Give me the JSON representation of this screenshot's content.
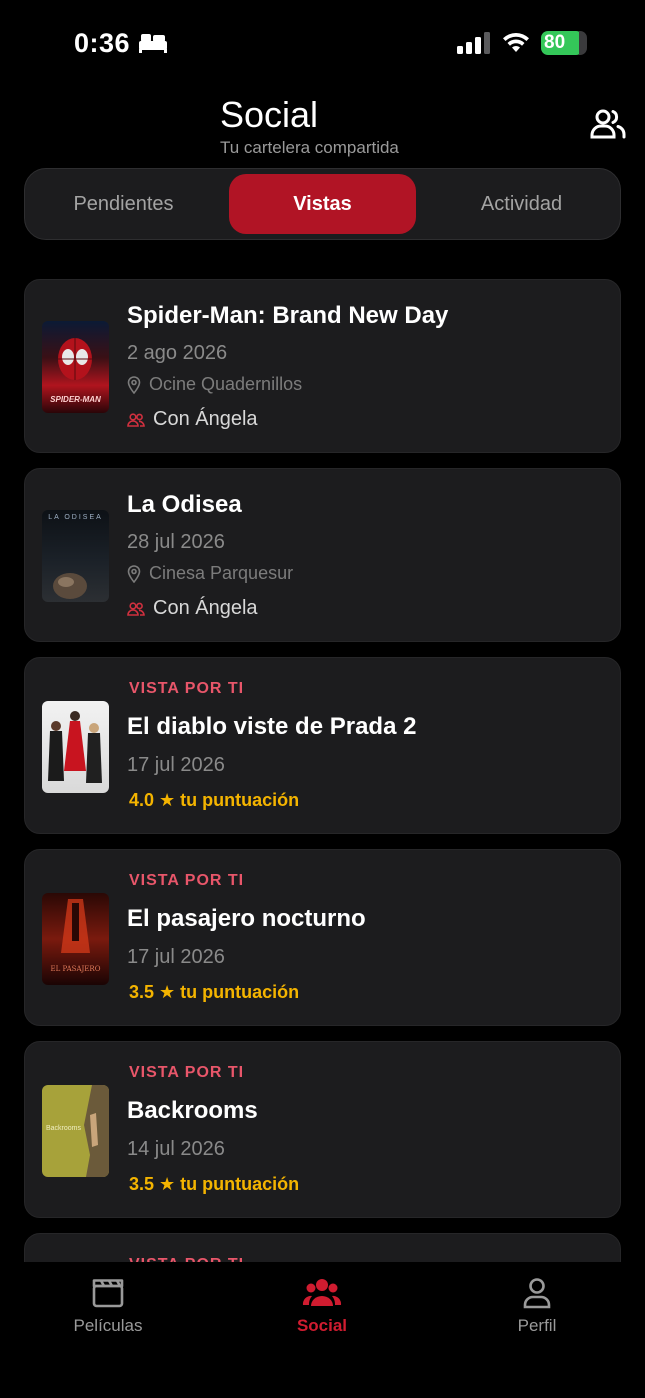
{
  "status_bar": {
    "time": "0:36",
    "battery": "80"
  },
  "header": {
    "title": "Social",
    "subtitle": "Tu cartelera compartida"
  },
  "segments": [
    "Pendientes",
    "Vistas",
    "Actividad"
  ],
  "cards": [
    {
      "title": "Spider-Man: Brand New Day",
      "date": "2 ago 2026",
      "cinema": "Ocine Quadernillos",
      "with": "Con Ángela",
      "poster_text": "SPIDER-MAN"
    },
    {
      "title": "La Odisea",
      "date": "28 jul 2026",
      "cinema": "Cinesa Parquesur",
      "with": "Con Ángela",
      "poster_text": "LA ODISEA"
    },
    {
      "tag": "VISTA POR TI",
      "title": "El diablo viste de Prada 2",
      "date": "17 jul 2026",
      "rating": "4.0 ★ tu puntuación"
    },
    {
      "tag": "VISTA POR TI",
      "title": "El pasajero nocturno",
      "date": "17 jul 2026",
      "rating": "3.5 ★ tu puntuación"
    },
    {
      "tag": "VISTA POR TI",
      "title": "Backrooms",
      "date": "14 jul 2026",
      "rating": "3.5 ★ tu puntuación",
      "poster_text": "Backrooms"
    },
    {
      "tag": "VISTA POR TI"
    }
  ],
  "tabs": [
    "Películas",
    "Social",
    "Perfil"
  ],
  "colors": {
    "accent": "#b11425",
    "tag": "#e8566a",
    "rating": "#f4b400"
  }
}
